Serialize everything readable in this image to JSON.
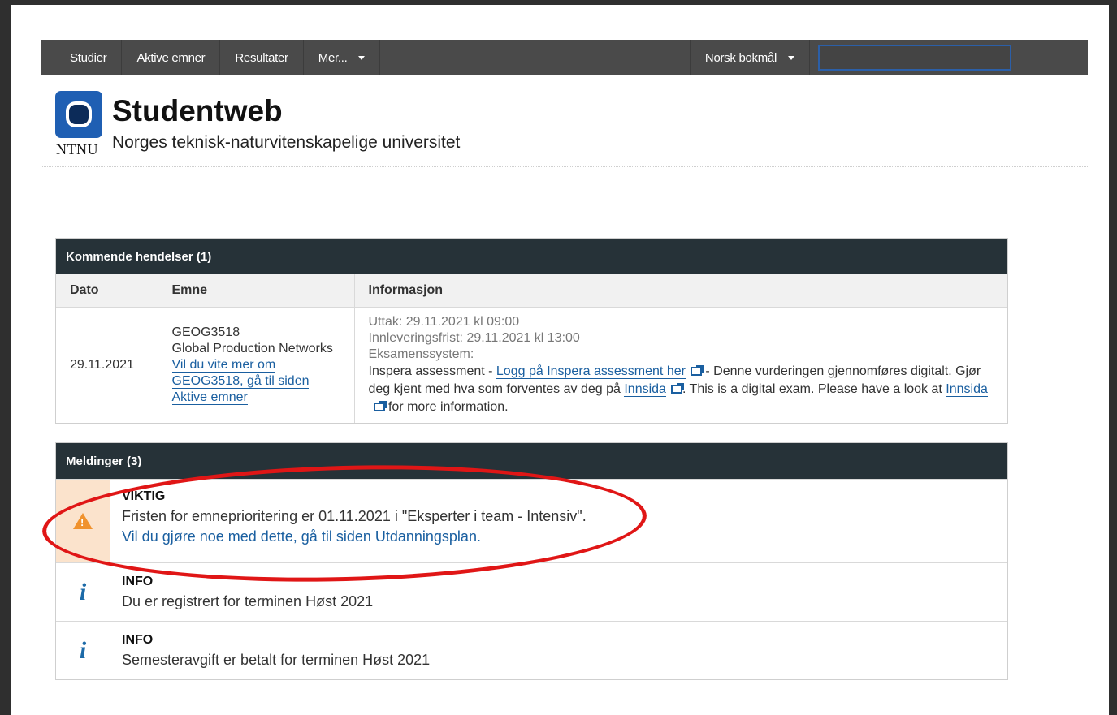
{
  "nav": {
    "items": [
      {
        "label": "Studier"
      },
      {
        "label": "Aktive emner"
      },
      {
        "label": "Resultater"
      },
      {
        "label": "Mer..."
      }
    ],
    "language": "Norsk bokmål"
  },
  "header": {
    "logo_text": "NTNU",
    "title": "Studentweb",
    "subtitle": "Norges teknisk-naturvitenskapelige universitet"
  },
  "events": {
    "heading": "Kommende hendelser (1)",
    "columns": [
      "Dato",
      "Emne",
      "Informasjon"
    ],
    "row": {
      "date": "29.11.2021",
      "course_code": "GEOG3518",
      "course_name": "Global Production Networks",
      "course_link": "Vil du vite mer om GEOG3518, gå til siden Aktive emner",
      "uttak": "Uttak: 29.11.2021 kl 09:00",
      "frist": "Innleveringsfrist: 29.11.2021 kl 13:00",
      "system_label": "Eksamenssystem:",
      "info_prefix": "Inspera assessment - ",
      "inspera_link": "Logg på Inspera assessment her",
      "info_mid": " - Denne vurderingen gjennomføres digitalt. Gjør deg kjent med hva som forventes av deg på ",
      "innsida_link1": "Innsida",
      "info_mid2": ". This is a digital exam. Please have a look at ",
      "innsida_link2": "Innsida",
      "info_end": " for more information."
    }
  },
  "messages": {
    "heading": "Meldinger (3)",
    "items": [
      {
        "type": "warning",
        "title": "VIKTIG",
        "text": "Fristen for emneprioritering er 01.11.2021 i \"Eksperter i team - Intensiv\".",
        "link": "Vil du gjøre noe med dette, gå til siden Utdanningsplan."
      },
      {
        "type": "info",
        "title": "INFO",
        "text": "Du er registrert for terminen Høst 2021"
      },
      {
        "type": "info",
        "title": "INFO",
        "text": "Semesteravgift er betalt for terminen Høst 2021"
      }
    ]
  },
  "colors": {
    "nav_bg": "#4a4a4a",
    "panel_head_bg": "#263238",
    "link": "#1a5fa0",
    "warning": "#f0922d",
    "annotation": "#e01616"
  }
}
